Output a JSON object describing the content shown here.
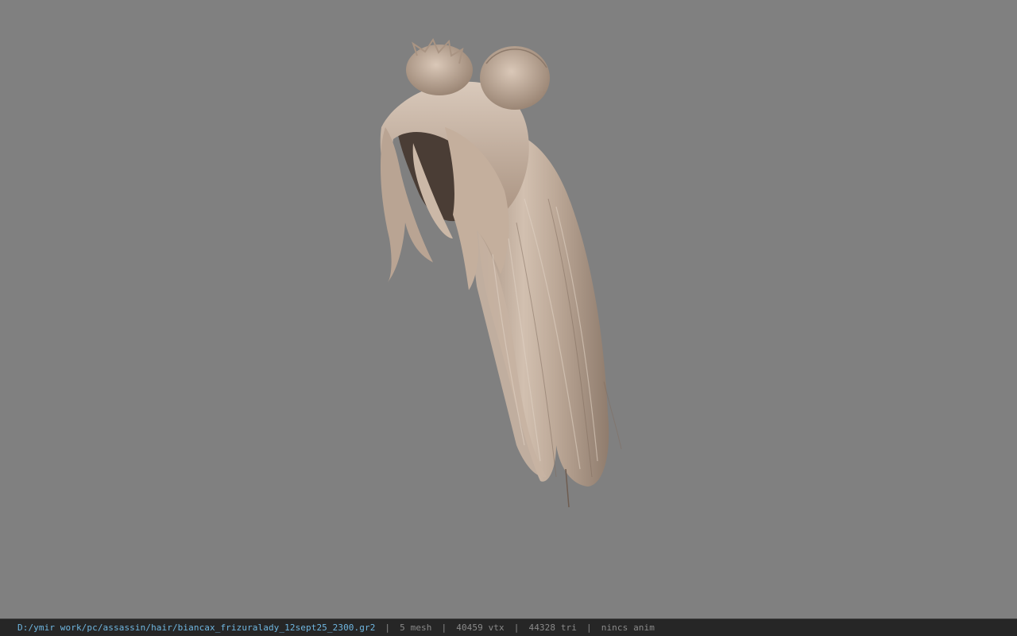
{
  "viewer": {
    "background_color": "#808080",
    "model_subject": "hair-mesh",
    "hair_color": "#c8b4a4"
  },
  "statusbar": {
    "file_path": "D:/ymir work/pc/assassin/hair/biancax_frizuralady_12sept25_2300.gr2",
    "separator": "|",
    "mesh_count": "5 mesh",
    "vertex_count": "40459 vtx",
    "triangle_count": "44328 tri",
    "anim_status": "nincs anim"
  }
}
